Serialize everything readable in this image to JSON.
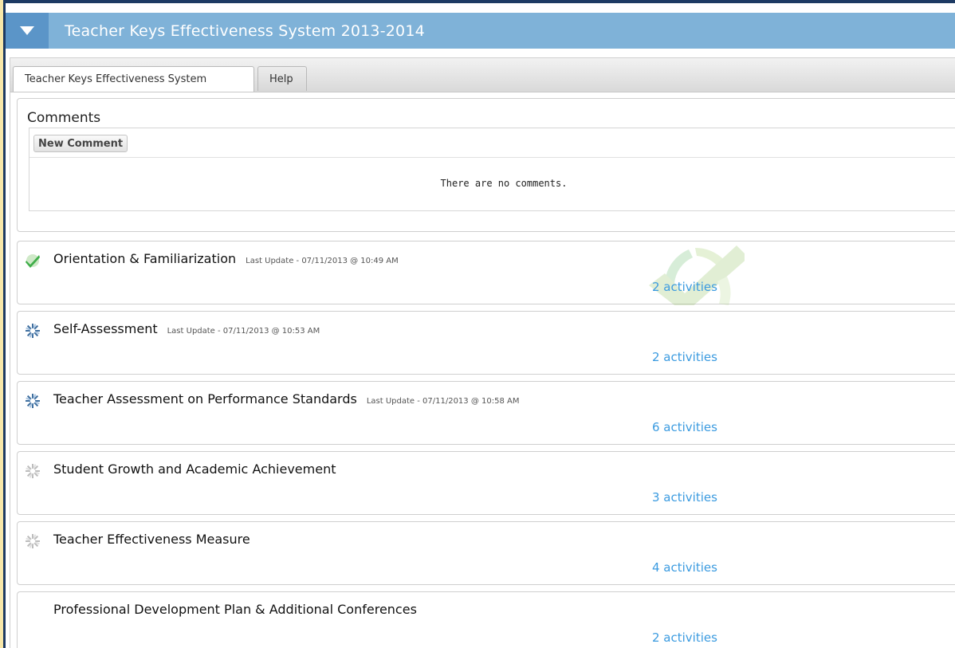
{
  "banner": {
    "title": "Teacher Keys Effectiveness System 2013-2014"
  },
  "tabs": [
    {
      "label": "Teacher Keys Effectiveness System",
      "active": true
    },
    {
      "label": "Help",
      "active": false
    }
  ],
  "comments": {
    "title": "Comments",
    "new_button": "New Comment",
    "empty_text": "There are no comments."
  },
  "phases": [
    {
      "title": "Orientation & Familiarization",
      "last_update": "Last Update - 07/11/2013 @ 10:49 AM",
      "activities": "2 activities",
      "status_icon": "complete-check-icon"
    },
    {
      "title": "Self-Assessment",
      "last_update": "Last Update - 07/11/2013 @ 10:53 AM",
      "activities": "2 activities",
      "status_icon": "in-progress-icon"
    },
    {
      "title": "Teacher Assessment on Performance Standards",
      "last_update": "Last Update - 07/11/2013 @ 10:58 AM",
      "activities": "6 activities",
      "status_icon": "in-progress-icon"
    },
    {
      "title": "Student Growth and Academic Achievement",
      "last_update": "",
      "activities": "3 activities",
      "status_icon": "not-started-icon"
    },
    {
      "title": "Teacher Effectiveness Measure",
      "last_update": "",
      "activities": "4 activities",
      "status_icon": "not-started-icon"
    },
    {
      "title": "Professional Development Plan & Additional Conferences",
      "last_update": "",
      "activities": "2 activities",
      "status_icon": "none"
    }
  ],
  "colors": {
    "banner": "#7fb2d8",
    "banner_toggle": "#5b95c8",
    "link": "#3b9be0",
    "complete": "#3fae49",
    "in_progress": "#3f6f9f",
    "not_started": "#bdbdbd"
  }
}
